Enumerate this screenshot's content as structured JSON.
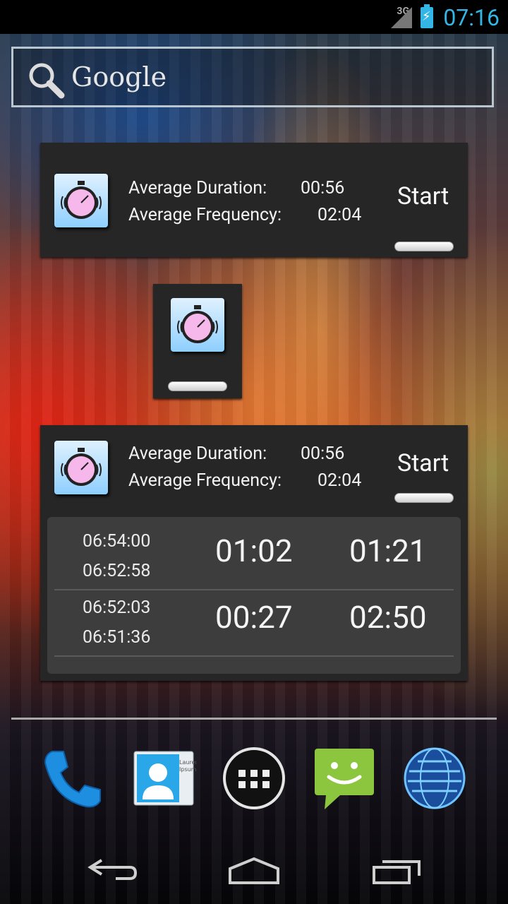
{
  "status_bar": {
    "network": "3G",
    "time": "07:16"
  },
  "search": {
    "placeholder": "Google"
  },
  "widget_large": {
    "avg_duration_label": "Average Duration:",
    "avg_duration_value": "00:56",
    "avg_frequency_label": "Average Frequency:",
    "avg_frequency_value": "02:04",
    "start_label": "Start"
  },
  "widget_history": {
    "avg_duration_label": "Average Duration:",
    "avg_duration_value": "00:56",
    "avg_frequency_label": "Average Frequency:",
    "avg_frequency_value": "02:04",
    "start_label": "Start",
    "rows": [
      {
        "end": "06:54:00",
        "start": "06:52:58",
        "duration": "01:02",
        "frequency": "01:21"
      },
      {
        "end": "06:52:03",
        "start": "06:51:36",
        "duration": "00:27",
        "frequency": "02:50"
      }
    ]
  },
  "dock": {
    "items": [
      "phone-icon",
      "contacts-icon",
      "apps-drawer-icon",
      "messaging-icon",
      "browser-icon"
    ],
    "contacts_card_text": "Lauren Ipsum"
  },
  "nav": {
    "items": [
      "back",
      "home",
      "recents"
    ]
  },
  "colors": {
    "accent": "#33b5e5",
    "widget_bg": "#262626",
    "history_bg": "#3d3d3d"
  }
}
